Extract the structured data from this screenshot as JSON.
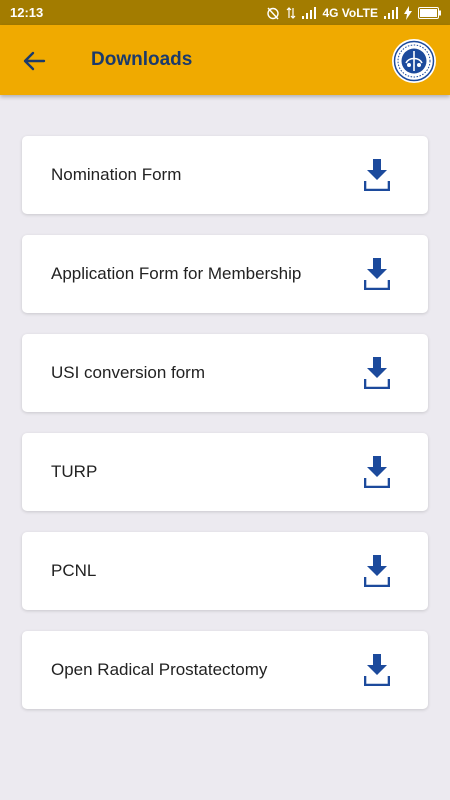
{
  "status_bar": {
    "time": "12:13",
    "network": "4G VoLTE"
  },
  "app_bar": {
    "title": "Downloads"
  },
  "downloads": [
    {
      "label": "Nomination Form"
    },
    {
      "label": "Application Form for Membership"
    },
    {
      "label": "USI conversion form"
    },
    {
      "label": "TURP"
    },
    {
      "label": "PCNL"
    },
    {
      "label": "Open Radical Prostatectomy"
    }
  ],
  "colors": {
    "app_bar": "#f0aa00",
    "status_bar": "#a37c00",
    "title": "#1b3a6b",
    "download_icon": "#1c4a9c",
    "background": "#eceaf0"
  },
  "icons": {
    "back": "arrow-left-icon",
    "logo": "organization-logo",
    "download": "download-icon"
  }
}
